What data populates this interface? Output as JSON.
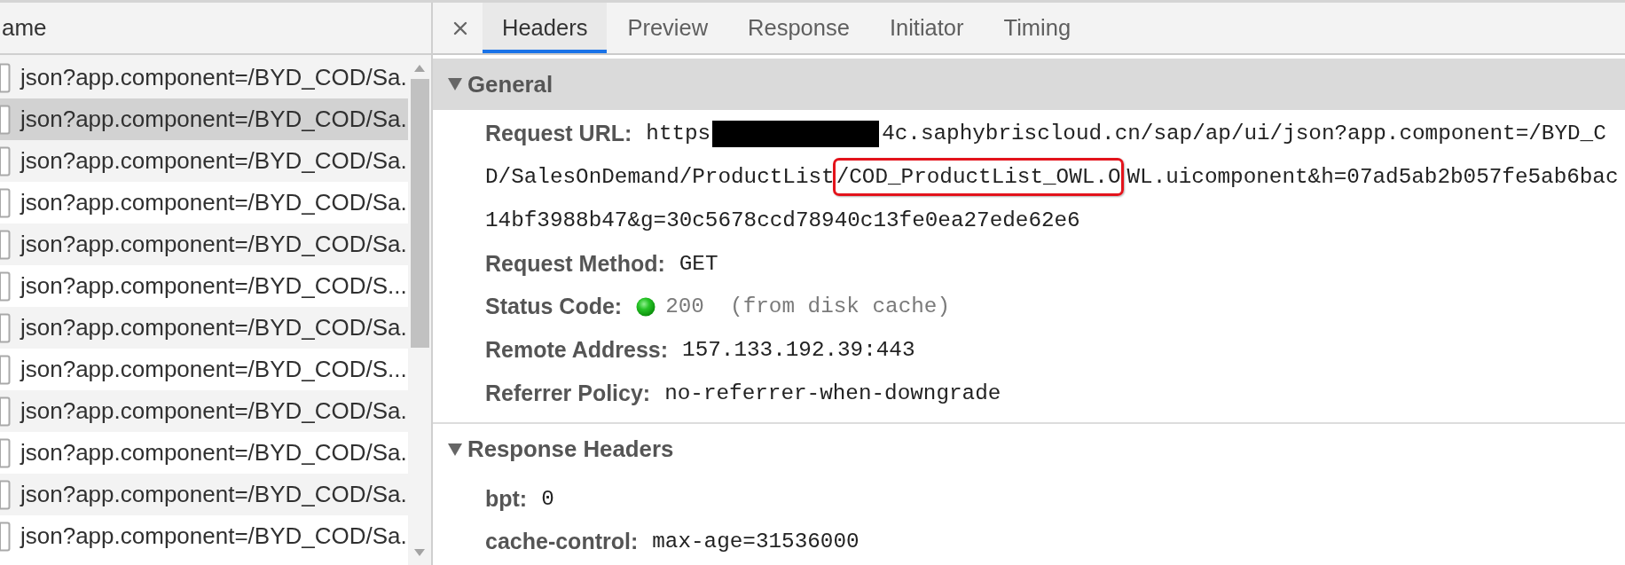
{
  "request_list": {
    "column_header": "ame",
    "rows": [
      {
        "name": "json?app.component=/BYD_COD/Sa.",
        "hovered": false
      },
      {
        "name": "json?app.component=/BYD_COD/Sa.",
        "hovered": true
      },
      {
        "name": "json?app.component=/BYD_COD/Sa.",
        "hovered": false
      },
      {
        "name": "json?app.component=/BYD_COD/Sa.",
        "hovered": false
      },
      {
        "name": "json?app.component=/BYD_COD/Sa.",
        "hovered": false
      },
      {
        "name": "json?app.component=/BYD_COD/S...",
        "hovered": false
      },
      {
        "name": "json?app.component=/BYD_COD/Sa.",
        "hovered": false
      },
      {
        "name": "json?app.component=/BYD_COD/S...",
        "hovered": false
      },
      {
        "name": "json?app.component=/BYD_COD/Sa.",
        "hovered": false
      },
      {
        "name": "json?app.component=/BYD_COD/Sa.",
        "hovered": false
      },
      {
        "name": "json?app.component=/BYD_COD/Sa.",
        "hovered": false
      },
      {
        "name": "json?app.component=/BYD_COD/Sa.",
        "hovered": false
      }
    ]
  },
  "detail_tabs": [
    {
      "label": "Headers",
      "selected": true
    },
    {
      "label": "Preview",
      "selected": false
    },
    {
      "label": "Response",
      "selected": false
    },
    {
      "label": "Initiator",
      "selected": false
    },
    {
      "label": "Timing",
      "selected": false
    }
  ],
  "sections": [
    {
      "title": "General",
      "expanded": true,
      "highlighted": true,
      "fields": [
        {
          "kind": "url",
          "label": "Request URL:",
          "lines": [
            [
              {
                "kind": "text",
                "text": "https"
              },
              {
                "kind": "redaction"
              },
              {
                "kind": "text",
                "text": "4c.saphybriscloud.cn/sap/ap/ui/json?app.component=/BYD_C"
              }
            ],
            [
              {
                "kind": "text",
                "text": "D/SalesOnDemand/ProductList"
              },
              {
                "kind": "highlight",
                "text": "/COD_ProductList_OWL.O"
              },
              {
                "kind": "text",
                "text": "WL.uicomponent&h=07ad5ab2b057fe5ab6bac"
              }
            ],
            [
              {
                "kind": "text",
                "text": "14bf3988b47&g=30c5678ccd78940c13fe0ea27ede62e6"
              }
            ]
          ]
        },
        {
          "kind": "text",
          "label": "Request Method:",
          "value": "GET"
        },
        {
          "kind": "status",
          "label": "Status Code:",
          "value": "200  (from disk cache)"
        },
        {
          "kind": "text",
          "label": "Remote Address:",
          "value": "157.133.192.39:443"
        },
        {
          "kind": "text",
          "label": "Referrer Policy:",
          "value": "no-referrer-when-downgrade"
        }
      ]
    },
    {
      "title": "Response Headers",
      "expanded": true,
      "highlighted": false,
      "fields": [
        {
          "kind": "text",
          "label": "bpt:",
          "value": "0"
        },
        {
          "kind": "text",
          "label": "cache-control:",
          "value": "max-age=31536000"
        }
      ]
    }
  ]
}
